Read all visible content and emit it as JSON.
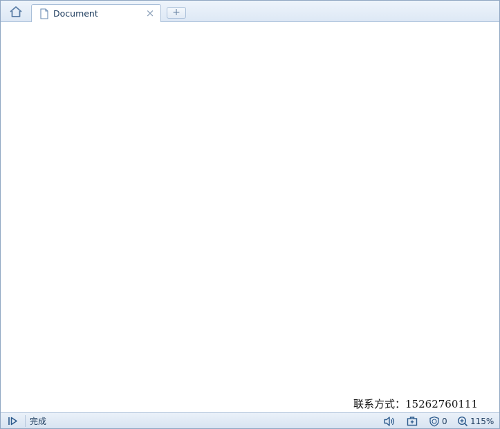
{
  "tabs": [
    {
      "title": "Document",
      "close_glyph": "×",
      "icon": "document-icon"
    }
  ],
  "tabbar": {
    "home_icon": "home-icon",
    "new_tab_glyph": "+"
  },
  "content": {
    "contact_text": "联系方式：15262760111"
  },
  "statusbar": {
    "status_text": "完成",
    "blocked_count": "0",
    "zoom_level": "115%"
  },
  "colors": {
    "accent": "#1c3a5c",
    "border": "#a9bfd9",
    "icon": "#5a7da6"
  }
}
